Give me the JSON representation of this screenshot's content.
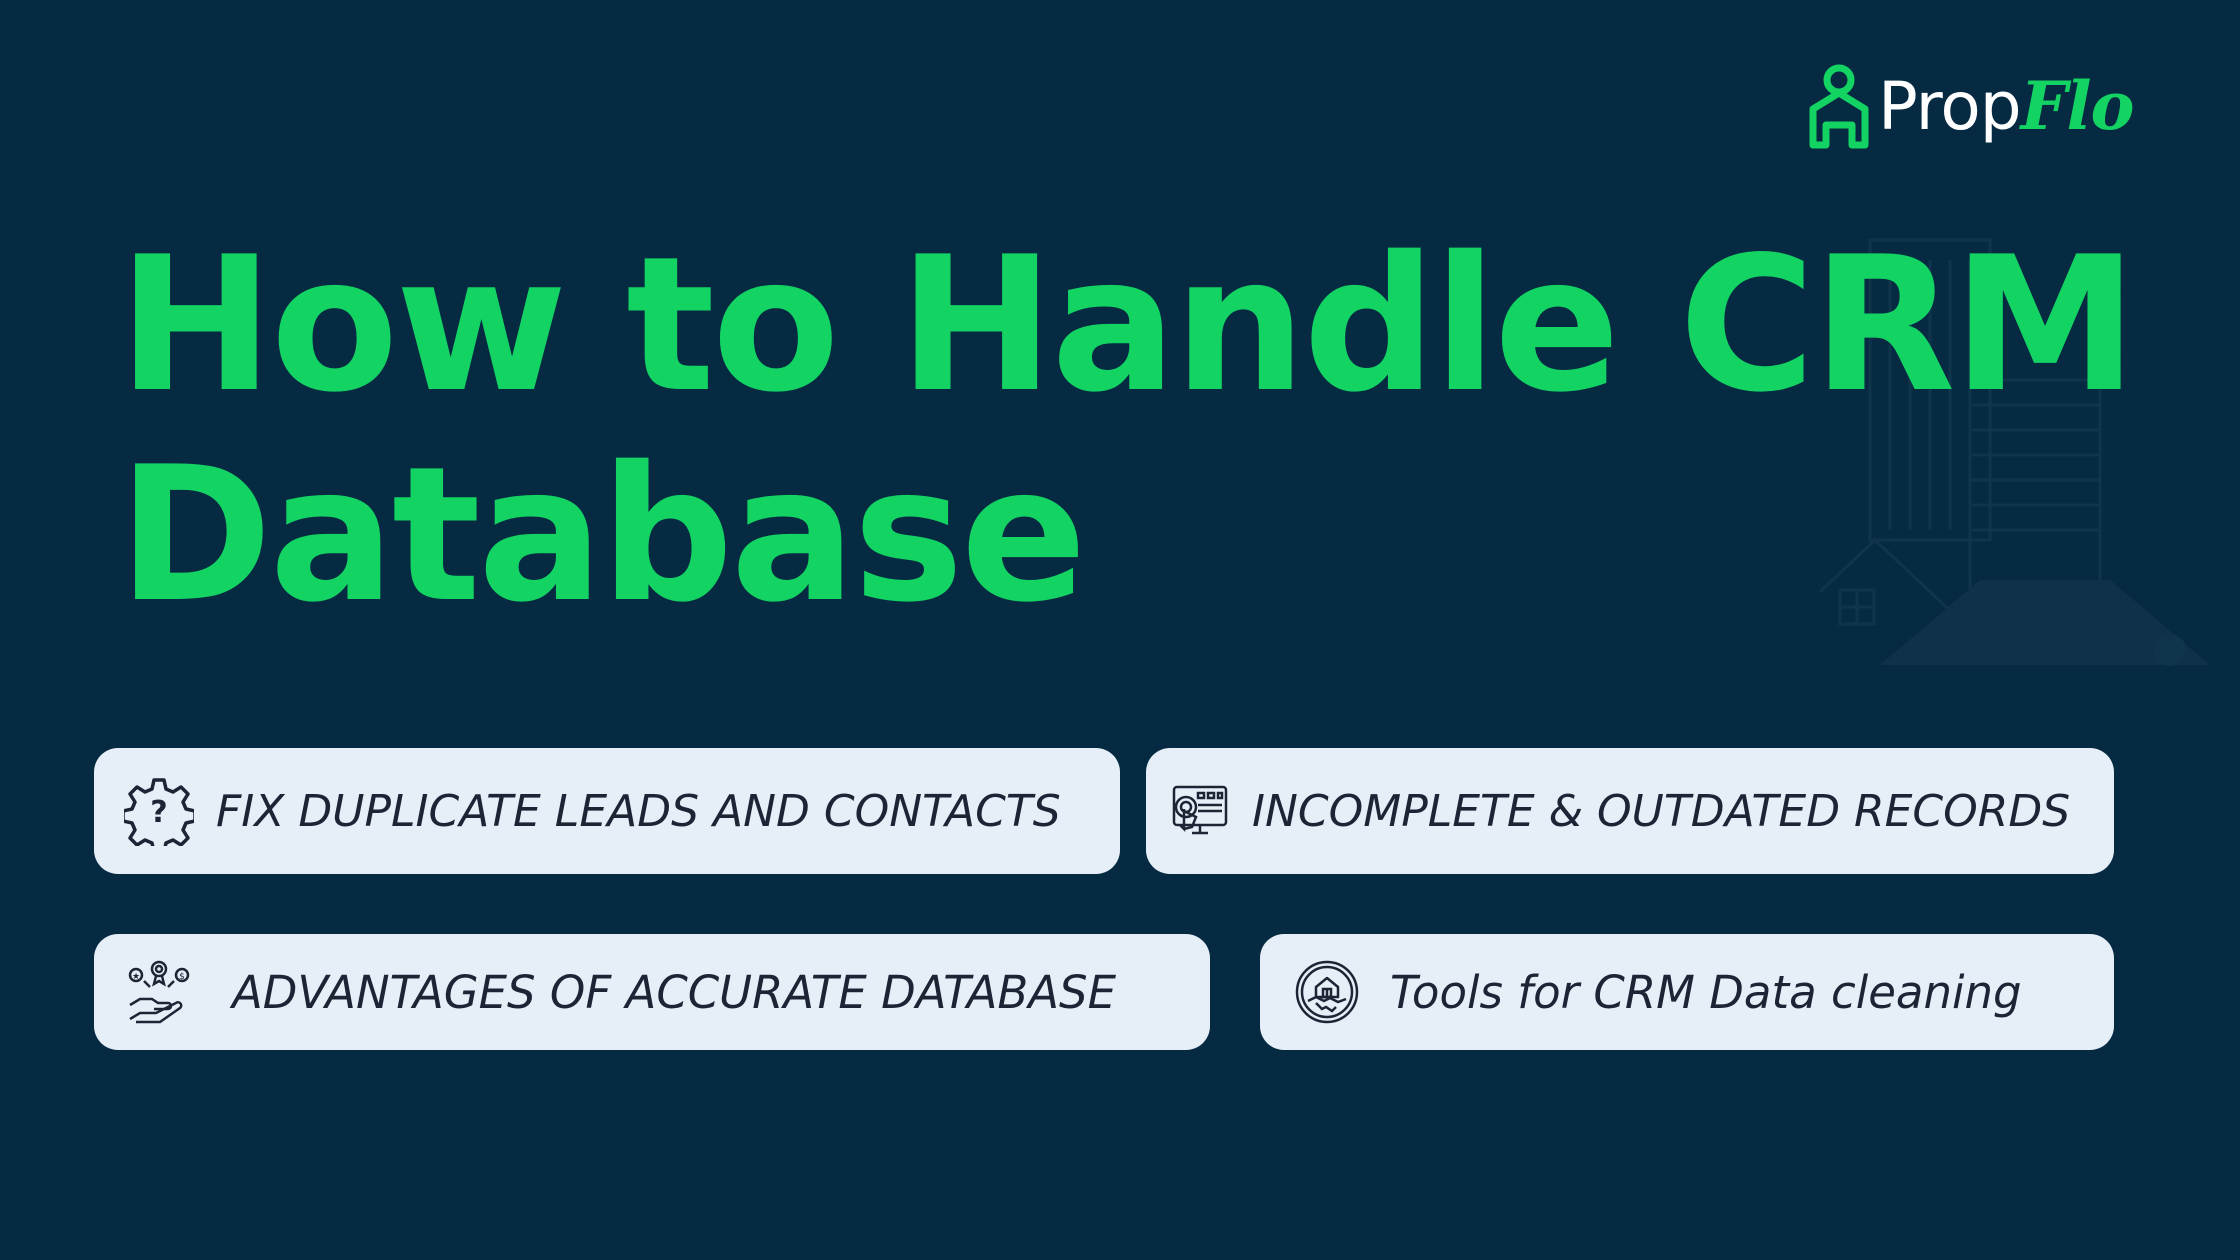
{
  "brand": {
    "name_prefix": "Prop",
    "name_suffix": "Flo",
    "logo_icon": "house-person-icon",
    "accent_color": "#13d363",
    "background_color": "#062a42"
  },
  "title": {
    "line1": "How to Handle CRM",
    "line2": "Database"
  },
  "topics": [
    {
      "icon": "gear-question-icon",
      "label": "FIX DUPLICATE LEADS AND CONTACTS"
    },
    {
      "icon": "monitor-touch-icon",
      "label": "INCOMPLETE & OUTDATED RECORDS"
    },
    {
      "icon": "hand-coins-icon",
      "label": "ADVANTAGES OF ACCURATE DATABASE"
    },
    {
      "icon": "house-handshake-icon",
      "label": "Tools for CRM Data cleaning"
    }
  ],
  "pill_color": "#e6eff8",
  "pill_text_color": "#1c2535"
}
